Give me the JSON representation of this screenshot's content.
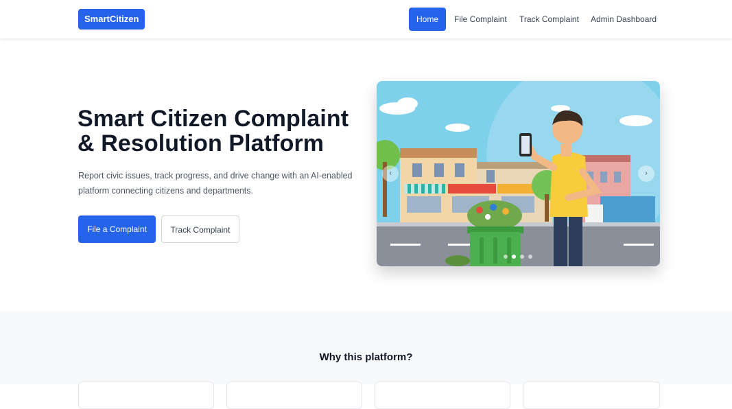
{
  "navbar": {
    "brand": "SmartCitizen",
    "links": [
      {
        "label": "Home",
        "active": true
      },
      {
        "label": "File Complaint",
        "active": false
      },
      {
        "label": "Track Complaint",
        "active": false
      },
      {
        "label": "Admin Dashboard",
        "active": false
      }
    ]
  },
  "hero": {
    "title": "Smart Citizen Complaint & Resolution Platform",
    "subtitle": "Report civic issues, track progress, and drive change with an AI-enabled platform connecting citizens and departments.",
    "primary_button": "File a Complaint",
    "secondary_button": "Track Complaint"
  },
  "carousel": {
    "prev_icon": "chevron-left-icon",
    "next_icon": "chevron-right-icon",
    "prev_glyph": "‹",
    "next_glyph": "›",
    "slide_count": 4,
    "active_slide": 2
  },
  "features": {
    "title": "Why this platform?"
  },
  "colors": {
    "primary": "#2563eb",
    "section_bg": "#f8f9fa"
  }
}
